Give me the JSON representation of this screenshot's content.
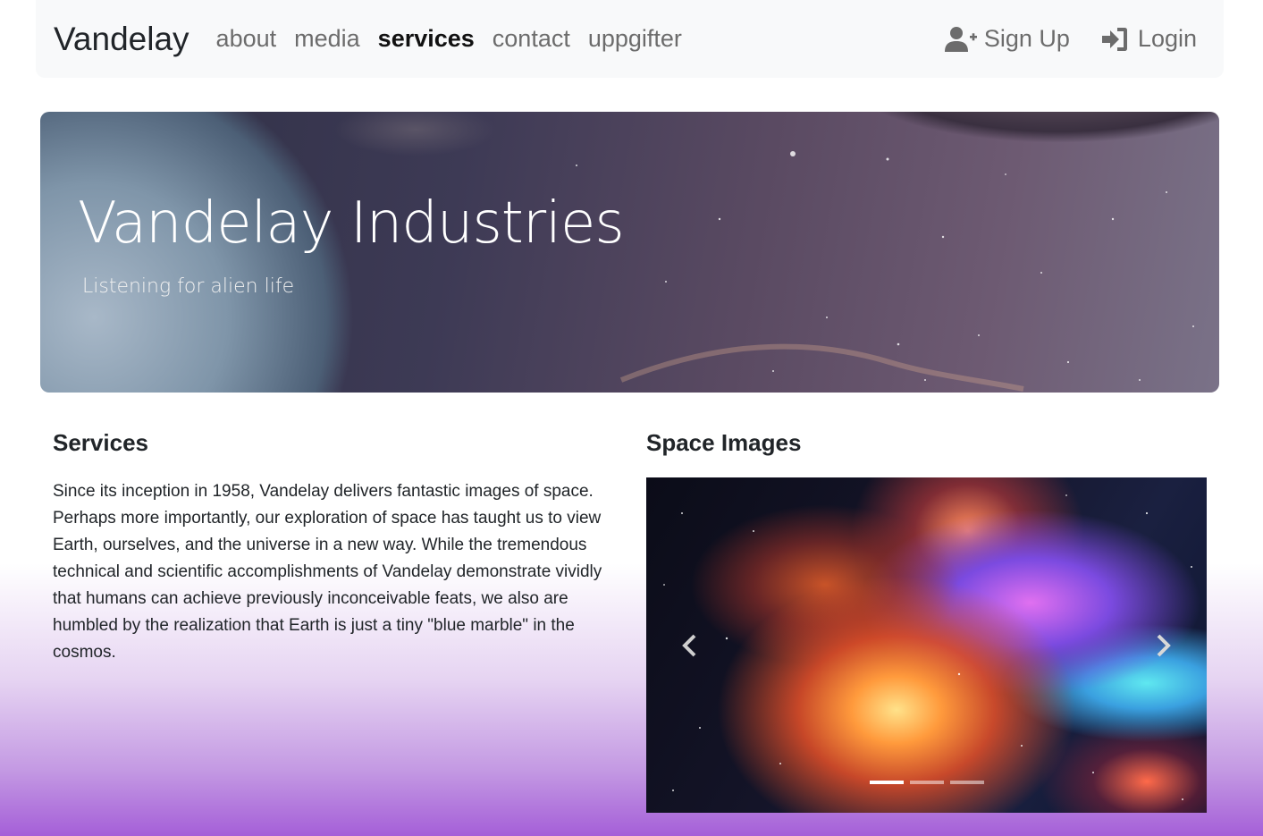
{
  "navbar": {
    "brand": "Vandelay",
    "links": [
      {
        "label": "about",
        "active": false
      },
      {
        "label": "media",
        "active": false
      },
      {
        "label": "services",
        "active": true
      },
      {
        "label": "contact",
        "active": false
      },
      {
        "label": "uppgifter",
        "active": false
      }
    ],
    "signup": {
      "label": "Sign Up",
      "icon": "user-plus-icon"
    },
    "login": {
      "label": "Login",
      "icon": "sign-in-icon"
    }
  },
  "hero": {
    "title": "Vandelay Industries",
    "subtitle": "Listening for alien life"
  },
  "services": {
    "heading": "Services",
    "text": "Since its inception in 1958, Vandelay delivers fantastic images of space. Perhaps more importantly, our exploration of space has taught us to view Earth, ourselves, and the universe in a new way. While the tremendous technical and scientific accomplishments of Vandelay demonstrate vividly that humans can achieve previously inconceivable feats, we also are humbled by the realization that Earth is just a tiny \"blue marble\" in the cosmos."
  },
  "space_images": {
    "heading": "Space Images",
    "prev_icon": "chevron-left-icon",
    "next_icon": "chevron-right-icon",
    "slide_count": 3,
    "active_slide": 1
  },
  "colors": {
    "navbar_bg": "#f8f9fa",
    "text": "#212529",
    "nav_link": "#6c6c6c",
    "gradient_bottom": "#a55fd8"
  }
}
